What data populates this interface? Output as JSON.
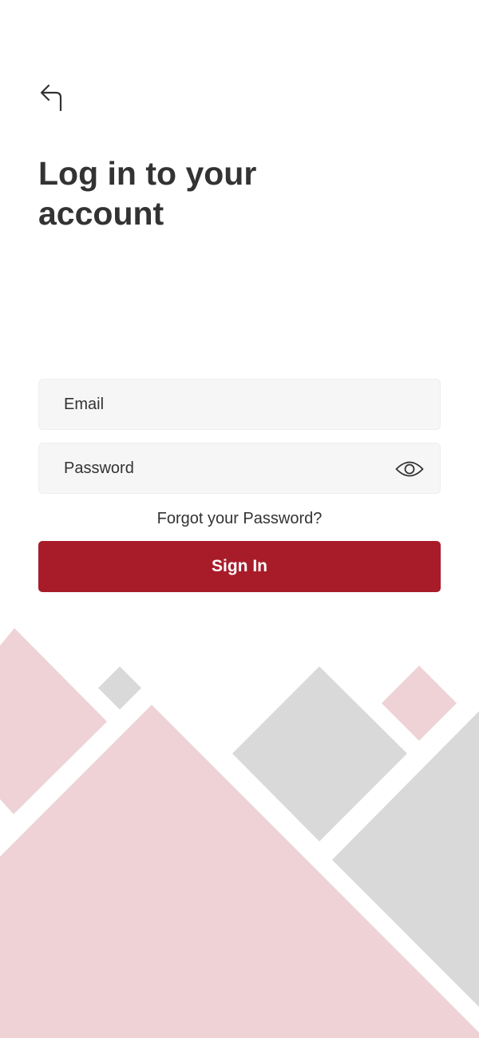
{
  "header": {
    "back_icon": "back-arrow-icon",
    "title": "Log in to your account"
  },
  "form": {
    "email_placeholder": "Email",
    "email_value": "",
    "password_placeholder": "Password",
    "password_value": "",
    "password_toggle_icon": "eye-icon",
    "forgot_password_label": "Forgot your Password?",
    "sign_in_label": "Sign In"
  },
  "colors": {
    "primary": "#a81c2a",
    "text": "#333333",
    "field_background": "#f6f6f6",
    "decoration_pink": "#eed2d5",
    "decoration_gray": "#d9d9d9"
  }
}
